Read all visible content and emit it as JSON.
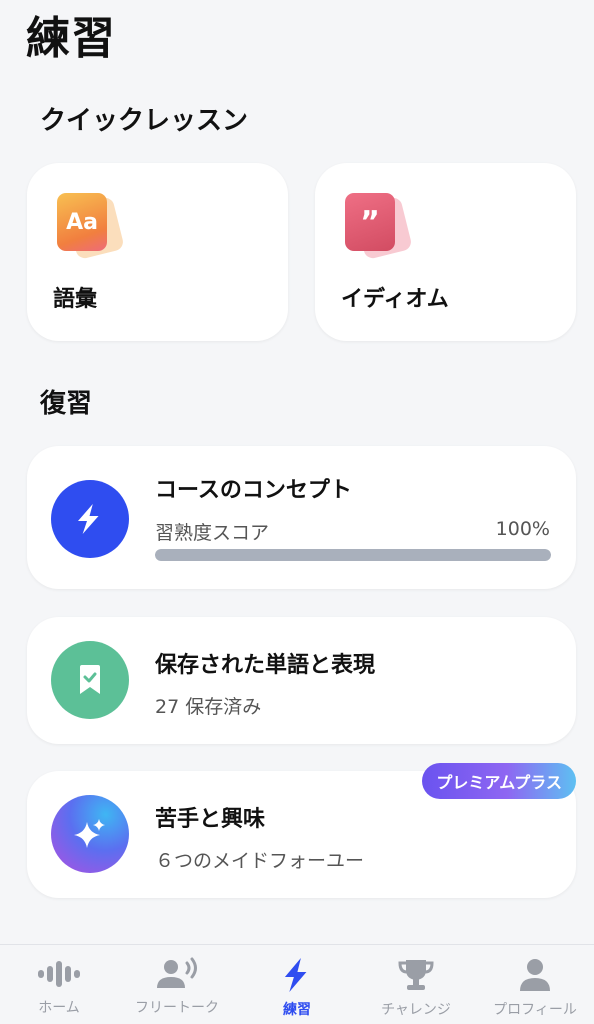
{
  "page": {
    "title": "練習"
  },
  "quick": {
    "title": "クイックレッスン",
    "cards": [
      {
        "label": "語彙",
        "icon": "vocabulary-cards-icon",
        "icon_text": "Aa"
      },
      {
        "label": "イディオム",
        "icon": "idiom-quote-cards-icon",
        "icon_text": "”"
      }
    ]
  },
  "review": {
    "title": "復習",
    "concept": {
      "title": "コースのコンセプト",
      "metric": "習熟度スコア",
      "percent": "100%",
      "progress": 1.0,
      "icon": "lightning-icon"
    },
    "saved": {
      "title": "保存された単語と表現",
      "subtitle": "27 保存済み",
      "icon": "bookmark-check-icon"
    },
    "weak": {
      "title": "苦手と興味",
      "subtitle": "６つのメイドフォーユー",
      "badge": "プレミアムプラス",
      "icon": "sparkle-icon"
    }
  },
  "tabs": [
    {
      "label": "ホーム",
      "icon": "home-waveform-icon",
      "active": false
    },
    {
      "label": "フリートーク",
      "icon": "free-talk-person-speaking-icon",
      "active": false
    },
    {
      "label": "練習",
      "icon": "lightning-icon",
      "active": true
    },
    {
      "label": "チャレンジ",
      "icon": "trophy-icon",
      "active": false
    },
    {
      "label": "プロフィール",
      "icon": "person-icon",
      "active": false
    }
  ],
  "colors": {
    "accent": "#2f4df0",
    "saved_green": "#5cc097",
    "badge_purple": "#7a5cf0"
  }
}
